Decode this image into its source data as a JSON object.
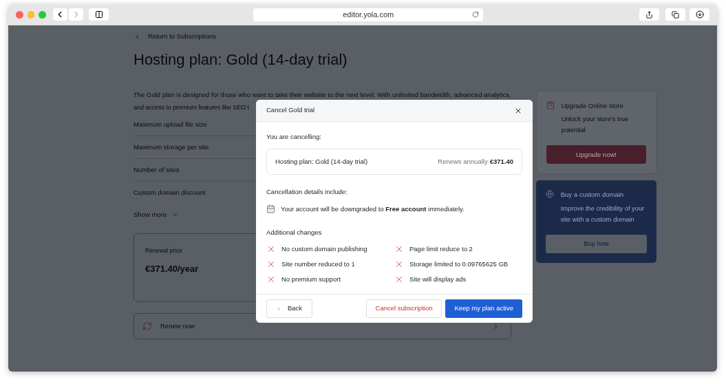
{
  "browser": {
    "url": "editor.yola.com"
  },
  "page": {
    "back_link": "Return to Subscriptions",
    "title": "Hosting plan: Gold (14-day trial)",
    "description": [
      "The Gold plan is designed for those who want to take their website to the next level. With unlimited bandwidth, advanced analytics,",
      "and access to premium features like SEO t"
    ],
    "features": [
      "Maximum upload file size",
      "Maximum storage per site",
      "Number of sites",
      "Custom domain discount"
    ],
    "show_more": "Show more",
    "renewal": {
      "label": "Renewal price",
      "price": "€371.40/year"
    },
    "renew_now": "Renew now"
  },
  "sidebar": [
    {
      "kind": "store",
      "title": "Upgrade Online store",
      "text": "Unlock your store's true potential",
      "button": "Upgrade now!"
    },
    {
      "kind": "domain",
      "title": "Buy a custom domain",
      "text": "Improve the credibility of your site with a custom domain",
      "button": "Buy now"
    }
  ],
  "dialog": {
    "title": "Cancel Gold trial",
    "cancelling_label": "You are cancelling:",
    "plan": {
      "name": "Hosting plan: Gold (14-day trial)",
      "renews": "Renews annually",
      "price": "€371.40"
    },
    "details_label": "Cancellation details include:",
    "detail": "Your account will be downgraded to **Free account** immediately.",
    "changes_label": "Additional changes",
    "changes": [
      "No custom domain publishing",
      "Page limit reduce to 2",
      "Site number reduced to 1",
      "Storage limited to 0.09765625 GB",
      "No premium support",
      "Site will display ads"
    ],
    "buttons": {
      "back": "Back",
      "cancel": "Cancel subscription",
      "keep": "Keep my plan active"
    }
  }
}
